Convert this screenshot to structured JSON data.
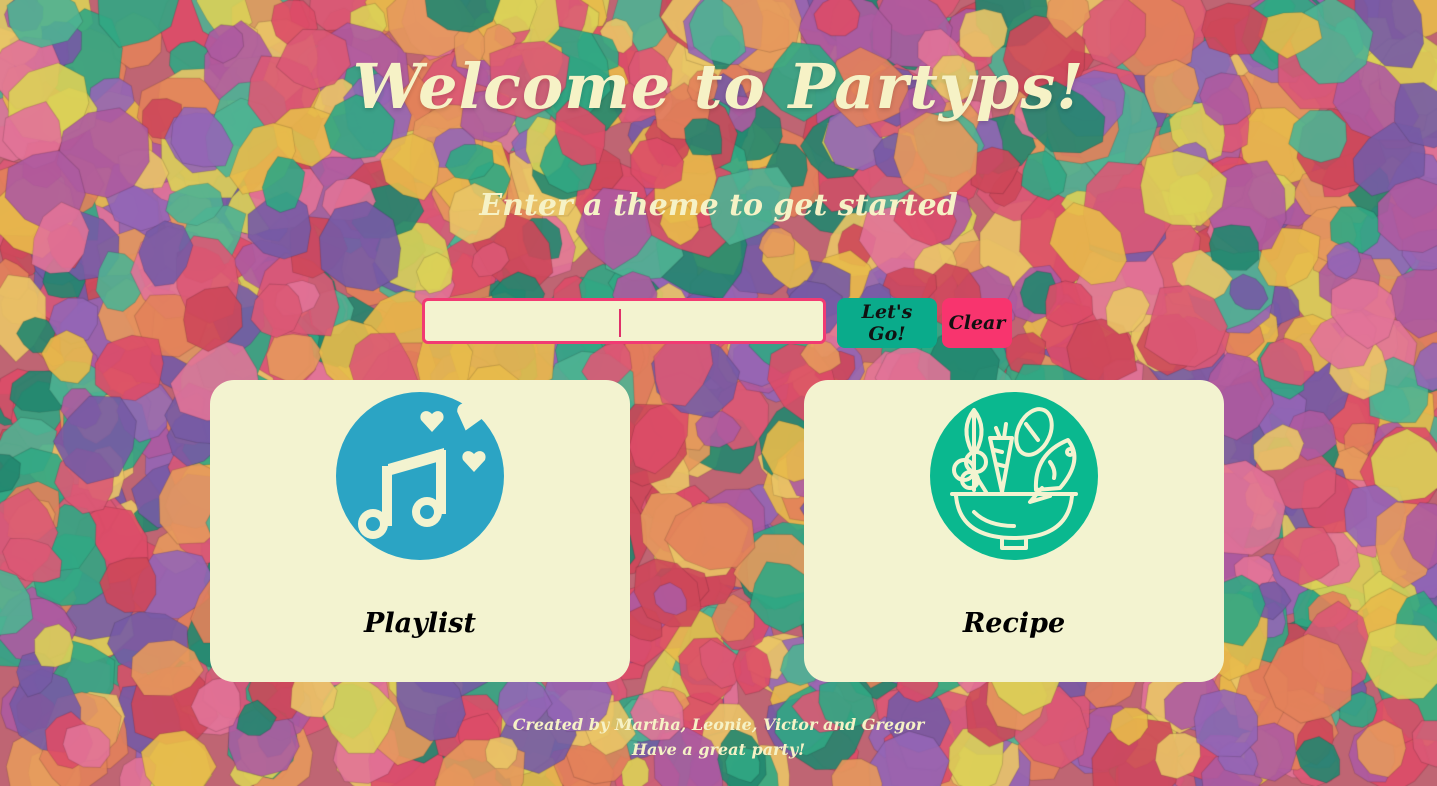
{
  "header": {
    "title": "Welcome to Partyps!",
    "subtitle": "Enter a theme to get started"
  },
  "search": {
    "value": "",
    "placeholder": ""
  },
  "buttons": {
    "go_label": "Let's Go!",
    "clear_label": "Clear"
  },
  "cards": [
    {
      "label": "Playlist",
      "icon": "music-note-icon",
      "icon_color": "#2ba4c4"
    },
    {
      "label": "Recipe",
      "icon": "salad-bowl-icon",
      "icon_color": "#0ab88f"
    }
  ],
  "footer": {
    "credits": "Created by Martha, Leonie, Victor and Gregor",
    "tagline": "Have a great party!"
  },
  "colors": {
    "text_cream": "#f6f2c6",
    "card_bg": "#f3f3d0",
    "go_button": "#0aab8b",
    "clear_button": "#f8346e",
    "input_border": "#f23a73"
  },
  "background": "confetti-image"
}
